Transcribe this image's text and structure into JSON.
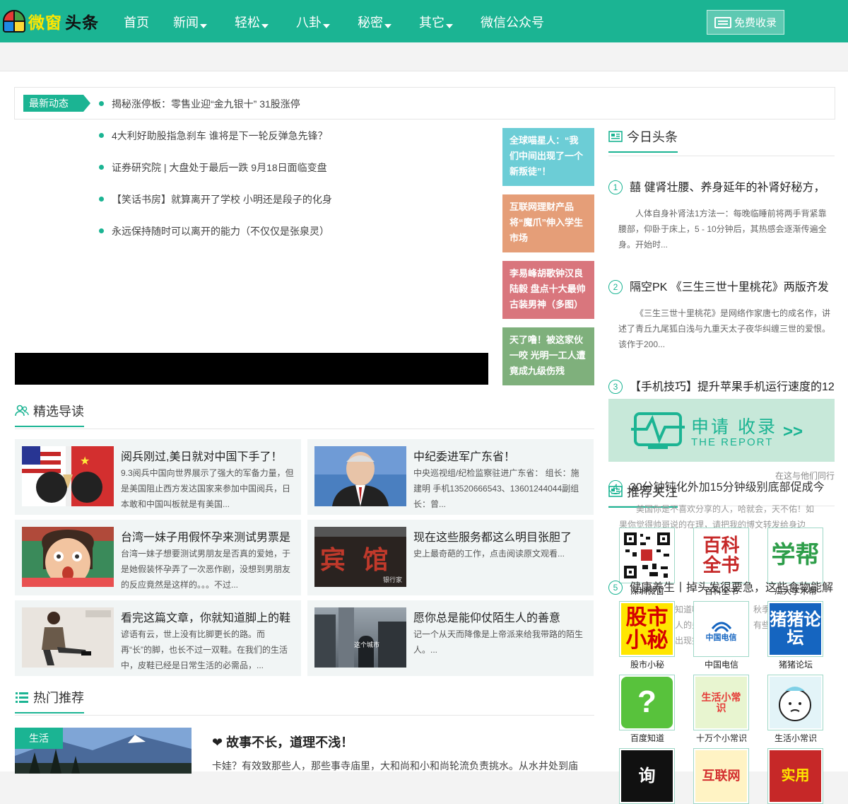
{
  "colors": {
    "brand": "#1bb493",
    "logo_yellow": "#ffe600"
  },
  "header": {
    "logo": {
      "part1": "微窗",
      "part2": "头条"
    },
    "nav": [
      {
        "label": "首页",
        "has_dropdown": false
      },
      {
        "label": "新闻",
        "has_dropdown": true
      },
      {
        "label": "轻松",
        "has_dropdown": true
      },
      {
        "label": "八卦",
        "has_dropdown": true
      },
      {
        "label": "秘密",
        "has_dropdown": true
      },
      {
        "label": "其它",
        "has_dropdown": true
      },
      {
        "label": "微信公众号",
        "has_dropdown": false
      }
    ],
    "free_button": "免费收录"
  },
  "ticker": {
    "label": "最新动态",
    "items": [
      "揭秘涨停板：零售业迎“金九银十” 31股涨停",
      "4大利好助股指急刹车 谁将是下一轮反弹急先锋？",
      "证券研究院 | 大盘处于最后一跌 9月18日面临变盘",
      "【笑话书房】就算离开了学校 小明还是段子的化身",
      "永远保持随时可以离开的能力（不仅仅是张泉灵）"
    ]
  },
  "tiles": [
    {
      "text": "全球喵星人：“我们中间出现了一个新叛徒”！",
      "color": "#6ccdd6"
    },
    {
      "text": "互联网理财产品将“魔爪”伸入学生市场",
      "color": "#e59e78"
    },
    {
      "text": "李易峰胡歌钟汉良陆毅 盘点十大最帅古装男神（多图）",
      "color": "#d9767d"
    },
    {
      "text": "天了噜！被这家伙一咬 光明一工人遭竟成九级伤残",
      "color": "#7fb07c"
    }
  ],
  "featured": {
    "title": "精选导读",
    "cards": [
      {
        "title": "阅兵刚过,美日就对中国下手了！",
        "desc": "9.3阅兵中国向世界展示了强大的军备力量，但是美国阻止西方发达国家来参加中国阅兵，日本敢和中国叫板就是有美国..."
      },
      {
        "title": "中纪委进军广东省！",
        "desc": "中央巡视组/纪检监察驻进广东省： 组长：施建明 手机13520666543、13601244044副组长：曾..."
      },
      {
        "title": "台湾一妹子用假怀孕来测试男票是",
        "desc": "台湾一妹子想要测试男朋友是否真的爱她，于是她假装怀孕弄了一次恶作剧，没想到男朋友的反应竟然是这样的。。。不过..."
      },
      {
        "title": "现在这些服务都这么明目张胆了",
        "desc": "史上最奇葩的工作，点击阅读原文观看..."
      },
      {
        "title": "看完这篇文章，你就知道脚上的鞋",
        "desc": "谚语有云，世上没有比脚更长的路。而再“长”的脚，也长不过一双鞋。在我们的生活中，皮鞋已经是日常生活的必需品，..."
      },
      {
        "title": "愿你总是能仰仗陌生人的善意",
        "desc": "记一个从天而降像是上帝派来给我带路的陌生人。..."
      }
    ],
    "thumb_texts": {
      "hotel": "宾 馆",
      "watermark": "银行家",
      "street": "这个城市"
    }
  },
  "hot": {
    "title": "热门推荐",
    "tag": "生活",
    "headline": "❤ 故事不长，道理不浅！",
    "desc": "卡娃？有效致那些人，那些事寺庙里，大和尚和小和尚轮流负责挑水。从水井处到庙"
  },
  "today": {
    "title": "今日头条",
    "items": [
      {
        "num": "1",
        "title": "囍 健肾壮腰、养身延年的补肾好秘方，",
        "desc": "人体自身补肾法1方法一：每晚临睡前将两手背紧靠腰部，仰卧于床上，5 - 10分钟后，其热感会逐渐传遍全身。开始时..."
      },
      {
        "num": "2",
        "title": "隔空PK 《三生三世十里桃花》两版齐发",
        "desc": "《三生三世十里桃花》是网络作家唐七的成名作，讲述了青丘九尾狐白浅与九重天太子夜华纠缠三世的爱恨。该作于200..."
      },
      {
        "num": "3",
        "title": "【手机技巧】提升苹果手机运行速度的12",
        "desc": ""
      }
    ]
  },
  "report": {
    "line1": "申请 收录",
    "line2": "THE REPORT",
    "arrow": ">>"
  },
  "overlap": {
    "ghost4": "30分钟钝化外加15分钟级别底部促成今",
    "ghost4_num": "4",
    "ghost_desc1": "美国你是不喜欢分享的人，哈就会，天不佑！如",
    "ghost_desc2": "果你觉得帅哥说的在理，请把我的博文转发给身边",
    "ghost5": "健康养生丨掉头发很要急，这些食物能解",
    "ghost5_num": "5",
    "ghost_desc3": "知道吗",
    "ghost_desc4": "秋季",
    "ghost_desc5": "人的头",
    "ghost_desc6": "有些",
    "ghost_desc7": "出现掉",
    "peer": "在这与他们同行"
  },
  "follow": {
    "title": "推荐关注",
    "items": [
      {
        "label": "深圳微窗",
        "img": "QR"
      },
      {
        "label": "百科全书",
        "img": "百科全书"
      },
      {
        "label": "瓜大学术帮",
        "img": "学帮"
      },
      {
        "label": "股市小秘",
        "img": "股市小秘"
      },
      {
        "label": "中国电信",
        "img": "中国电信"
      },
      {
        "label": "猪猪论坛",
        "img": "猪猪论坛"
      },
      {
        "label": "百度知道",
        "img": "?"
      },
      {
        "label": "十万个小常识",
        "img": "生活小常识"
      },
      {
        "label": "生活小常识",
        "img": ""
      },
      {
        "label": "",
        "img": "询"
      },
      {
        "label": "",
        "img": "互联网"
      },
      {
        "label": "",
        "img": "实用"
      }
    ]
  }
}
